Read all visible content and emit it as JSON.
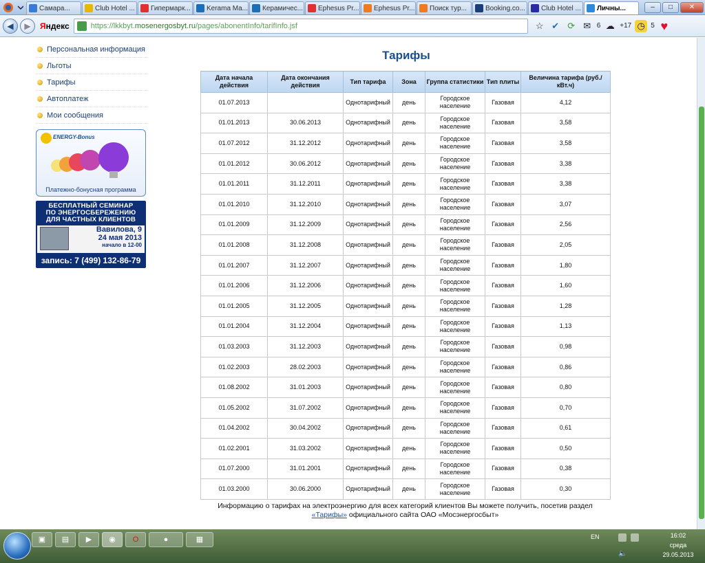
{
  "browser": {
    "tabs": [
      {
        "label": "Самара...",
        "fav_color": "#3a7bd5"
      },
      {
        "label": "Club Hotel ...",
        "fav_color": "#e8b800"
      },
      {
        "label": "Гипермарк...",
        "fav_color": "#e03030"
      },
      {
        "label": "Kerama Ma...",
        "fav_color": "#1a6fb8"
      },
      {
        "label": "Керамичес...",
        "fav_color": "#1a6fb8"
      },
      {
        "label": "Ephesus Pr...",
        "fav_color": "#e03030"
      },
      {
        "label": "Ephesus Pr...",
        "fav_color": "#f07a20"
      },
      {
        "label": "Поиск тур...",
        "fav_color": "#f07a20"
      },
      {
        "label": "Booking.co...",
        "fav_color": "#1a3f78"
      },
      {
        "label": "Club Hotel ...",
        "fav_color": "#2a2aa8"
      },
      {
        "label": "Личны...",
        "fav_color": "#2e8ad8",
        "active": true
      }
    ],
    "brand_letter": "Я",
    "brand_rest": "ндекс",
    "url_scheme": "https://lkkbyt.",
    "url_host": "mosenergosbyt.ru",
    "url_path": "/pages/abonentInfo/tarifInfo.jsf",
    "toolbar_count_1": "6",
    "toolbar_temp": "+17",
    "toolbar_count_2": "5"
  },
  "sidebar": {
    "items": [
      {
        "label": "Персональная информация"
      },
      {
        "label": "Льготы"
      },
      {
        "label": "Тарифы"
      },
      {
        "label": "Автоплатеж"
      },
      {
        "label": "Мои сообщения"
      }
    ],
    "banner_bonus": {
      "logo": "ENERGY-Bonus",
      "caption": "Платежно-бонусная программа"
    },
    "banner_seminar": {
      "line1": "БЕСПЛАТНЫЙ СЕМИНАР",
      "line2": "ПО ЭНЕРГОСБЕРЕЖЕНИЮ",
      "line3": "ДЛЯ ЧАСТНЫХ КЛИЕНТОВ",
      "address": "Вавилова, 9",
      "date": "24 мая 2013",
      "time": "начало в 12-00",
      "phone": "запись: 7 (499) 132-86-79"
    }
  },
  "main": {
    "title": "Тарифы",
    "columns": [
      "Дата начала действия",
      "Дата окончания действия",
      "Тип тарифа",
      "Зона",
      "Группа статистики",
      "Тип плиты",
      "Величина тарифа (руб./кВт.ч)"
    ],
    "rows": [
      [
        "01.07.2013",
        "",
        "Однотарифный",
        "день",
        "Городское население",
        "Газовая",
        "4,12"
      ],
      [
        "01.01.2013",
        "30.06.2013",
        "Однотарифный",
        "день",
        "Городское население",
        "Газовая",
        "3,58"
      ],
      [
        "01.07.2012",
        "31.12.2012",
        "Однотарифный",
        "день",
        "Городское население",
        "Газовая",
        "3,58"
      ],
      [
        "01.01.2012",
        "30.06.2012",
        "Однотарифный",
        "день",
        "Городское население",
        "Газовая",
        "3,38"
      ],
      [
        "01.01.2011",
        "31.12.2011",
        "Однотарифный",
        "день",
        "Городское население",
        "Газовая",
        "3,38"
      ],
      [
        "01.01.2010",
        "31.12.2010",
        "Однотарифный",
        "день",
        "Городское население",
        "Газовая",
        "3,07"
      ],
      [
        "01.01.2009",
        "31.12.2009",
        "Однотарифный",
        "день",
        "Городское население",
        "Газовая",
        "2,56"
      ],
      [
        "01.01.2008",
        "31.12.2008",
        "Однотарифный",
        "день",
        "Городское население",
        "Газовая",
        "2,05"
      ],
      [
        "01.01.2007",
        "31.12.2007",
        "Однотарифный",
        "день",
        "Городское население",
        "Газовая",
        "1,80"
      ],
      [
        "01.01.2006",
        "31.12.2006",
        "Однотарифный",
        "день",
        "Городское население",
        "Газовая",
        "1,60"
      ],
      [
        "01.01.2005",
        "31.12.2005",
        "Однотарифный",
        "день",
        "Городское население",
        "Газовая",
        "1,28"
      ],
      [
        "01.01.2004",
        "31.12.2004",
        "Однотарифный",
        "день",
        "Городское население",
        "Газовая",
        "1,13"
      ],
      [
        "01.03.2003",
        "31.12.2003",
        "Однотарифный",
        "день",
        "Городское население",
        "Газовая",
        "0,98"
      ],
      [
        "01.02.2003",
        "28.02.2003",
        "Однотарифный",
        "день",
        "Городское население",
        "Газовая",
        "0,86"
      ],
      [
        "01.08.2002",
        "31.01.2003",
        "Однотарифный",
        "день",
        "Городское население",
        "Газовая",
        "0,80"
      ],
      [
        "01.05.2002",
        "31.07.2002",
        "Однотарифный",
        "день",
        "Городское население",
        "Газовая",
        "0,70"
      ],
      [
        "01.04.2002",
        "30.04.2002",
        "Однотарифный",
        "день",
        "Городское население",
        "Газовая",
        "0,61"
      ],
      [
        "01.02.2001",
        "31.03.2002",
        "Однотарифный",
        "день",
        "Городское население",
        "Газовая",
        "0,50"
      ],
      [
        "01.07.2000",
        "31.01.2001",
        "Однотарифный",
        "день",
        "Городское население",
        "Газовая",
        "0,38"
      ],
      [
        "01.03.2000",
        "30.06.2000",
        "Однотарифный",
        "день",
        "Городское население",
        "Газовая",
        "0,30"
      ]
    ],
    "note_before": "Информацию о тарифах на электроэнергию для всех категорий клиентов Вы можете получить, посетив раздел ",
    "note_link": "«Тарифы»",
    "note_after": " официального сайта ОАО «Мосэнергосбыт»"
  },
  "taskbar": {
    "lang": "EN",
    "time": "16:02",
    "weekday": "среда",
    "date": "29.05.2013"
  },
  "colors": {
    "title": "#1a4f8b",
    "header_bg": "#c9dff5",
    "scroll_thumb": "#59b14c"
  }
}
